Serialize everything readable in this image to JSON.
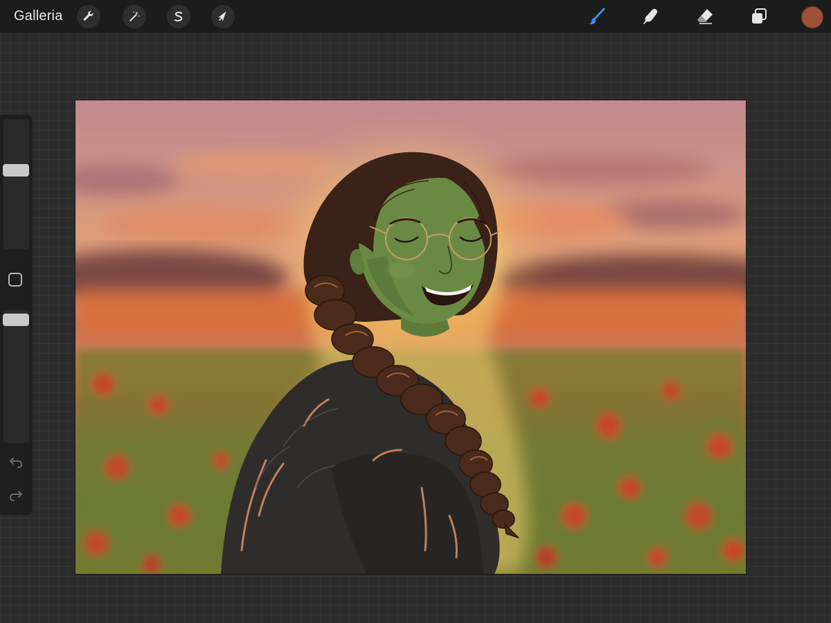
{
  "topbar": {
    "gallery_label": "Galleria",
    "left_tools": [
      {
        "name": "actions",
        "icon": "wrench-icon"
      },
      {
        "name": "adjustments",
        "icon": "magic-wand-icon"
      },
      {
        "name": "selection",
        "icon": "selection-s-icon"
      },
      {
        "name": "transform",
        "icon": "arrow-cursor-icon"
      }
    ],
    "right_tools": [
      {
        "name": "brush",
        "icon": "brush-icon",
        "active": true
      },
      {
        "name": "smudge",
        "icon": "smudge-finger-icon",
        "active": false
      },
      {
        "name": "eraser",
        "icon": "eraser-icon",
        "active": false
      },
      {
        "name": "layers",
        "icon": "layers-icon",
        "active": false
      }
    ],
    "current_color": "#9c5038",
    "active_tool_color": "#3c8cf0"
  },
  "sidebar": {
    "brush_size_level": 0.62,
    "opacity_level": 0.97
  },
  "canvas": {
    "artwork": "illustration"
  }
}
